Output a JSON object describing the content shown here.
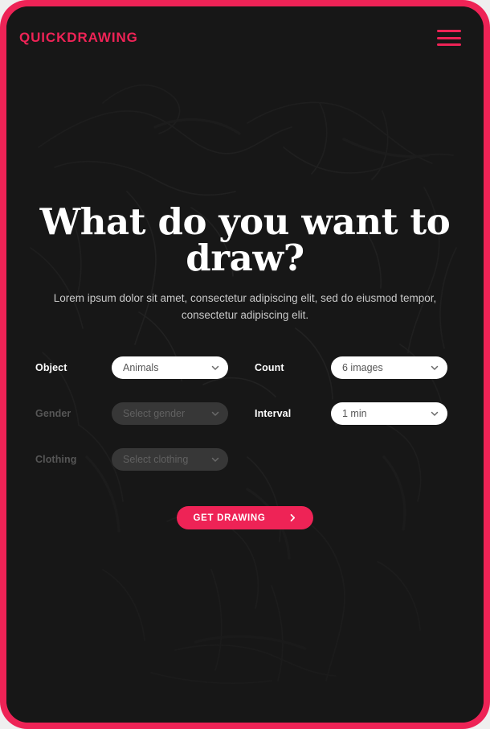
{
  "theme": {
    "accent": "#ee2356",
    "stage_bg": "#171717",
    "page_bg": "#efefef",
    "text_primary": "#ffffff",
    "text_muted": "#c9c9c9",
    "text_disabled": "#565656",
    "select_bg": "#ffffff",
    "select_bg_disabled": "#373737",
    "select_text": "#555555"
  },
  "header": {
    "logo": "QUICKDRAWING",
    "menu_icon": "hamburger-menu-icon"
  },
  "hero": {
    "headline": "What do you want to draw?",
    "subhead": "Lorem ipsum dolor sit amet, consectetur adipiscing elit, sed do eiusmod tempor, consectetur adipiscing elit."
  },
  "form": {
    "left_fields": [
      {
        "label": "Object",
        "value": "Animals",
        "disabled": false,
        "name": "object"
      },
      {
        "label": "Gender",
        "value": "Select gender",
        "disabled": true,
        "name": "gender"
      },
      {
        "label": "Clothing",
        "value": "Select clothing",
        "disabled": true,
        "name": "clothing"
      }
    ],
    "right_fields": [
      {
        "label": "Count",
        "value": "6 images",
        "disabled": false,
        "name": "count"
      },
      {
        "label": "Interval",
        "value": "1 min",
        "disabled": false,
        "name": "interval"
      }
    ],
    "chevron_icon": "chevron-down-icon"
  },
  "cta": {
    "label": "GET DRAWING",
    "arrow_icon": "chevron-right-icon"
  }
}
